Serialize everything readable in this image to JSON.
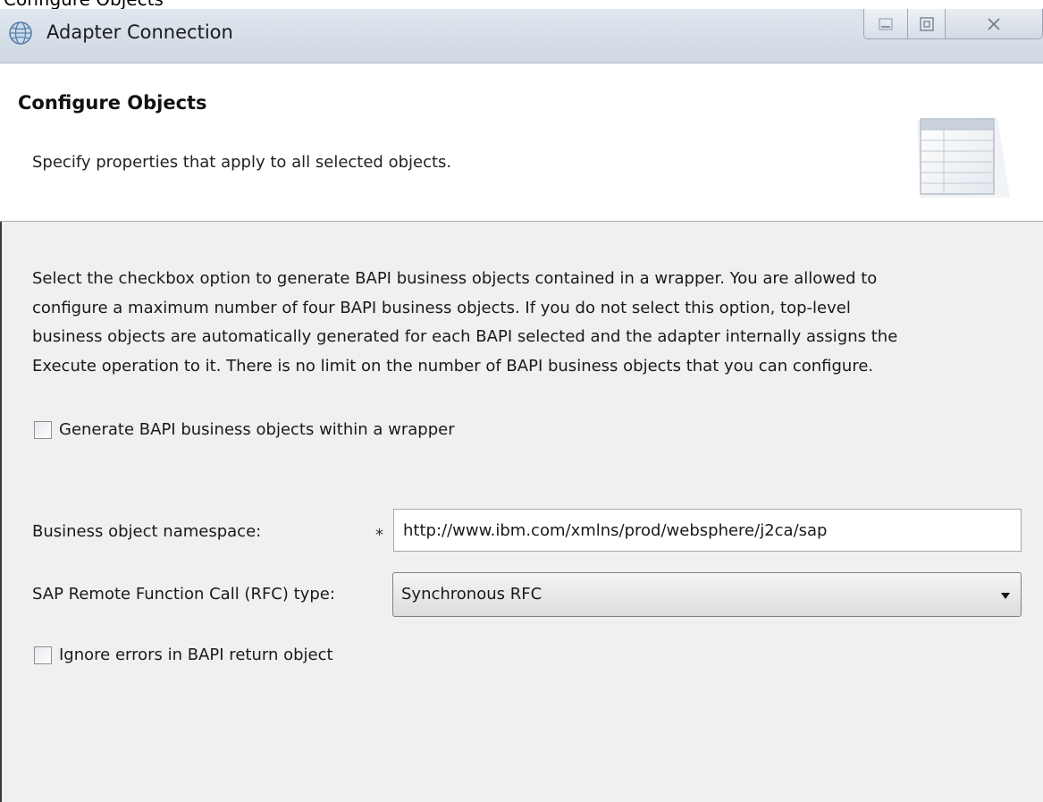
{
  "window": {
    "cropped_caption": "Configure Objects",
    "title": "Adapter Connection"
  },
  "header": {
    "title": "Configure Objects",
    "description": "Specify properties that apply to all selected objects."
  },
  "body": {
    "instructions": [
      "Select the checkbox option to generate BAPI business objects contained in a wrapper. You are allowed to",
      "configure a maximum number of four BAPI business objects. If you do not select this option, top-level",
      "business objects are automatically generated for each BAPI selected and the adapter internally assigns the",
      "Execute operation to it. There is no limit on the number of BAPI business objects that you can configure."
    ],
    "wrapper_checkbox": {
      "label": "Generate BAPI business objects within a wrapper",
      "checked": false
    },
    "namespace": {
      "label": "Business object namespace:",
      "required_marker": "*",
      "value": "http://www.ibm.com/xmlns/prod/websphere/j2ca/sap"
    },
    "rfc_type": {
      "label": "SAP Remote Function Call (RFC) type:",
      "selected": "Synchronous RFC"
    },
    "ignore_errors_checkbox": {
      "label": "Ignore errors in BAPI return object",
      "checked": false
    }
  },
  "icons": {
    "app": "globe-icon",
    "header": "table-icon",
    "minimize": "minimize-icon",
    "maximize": "maximize-icon",
    "close": "close-icon"
  }
}
